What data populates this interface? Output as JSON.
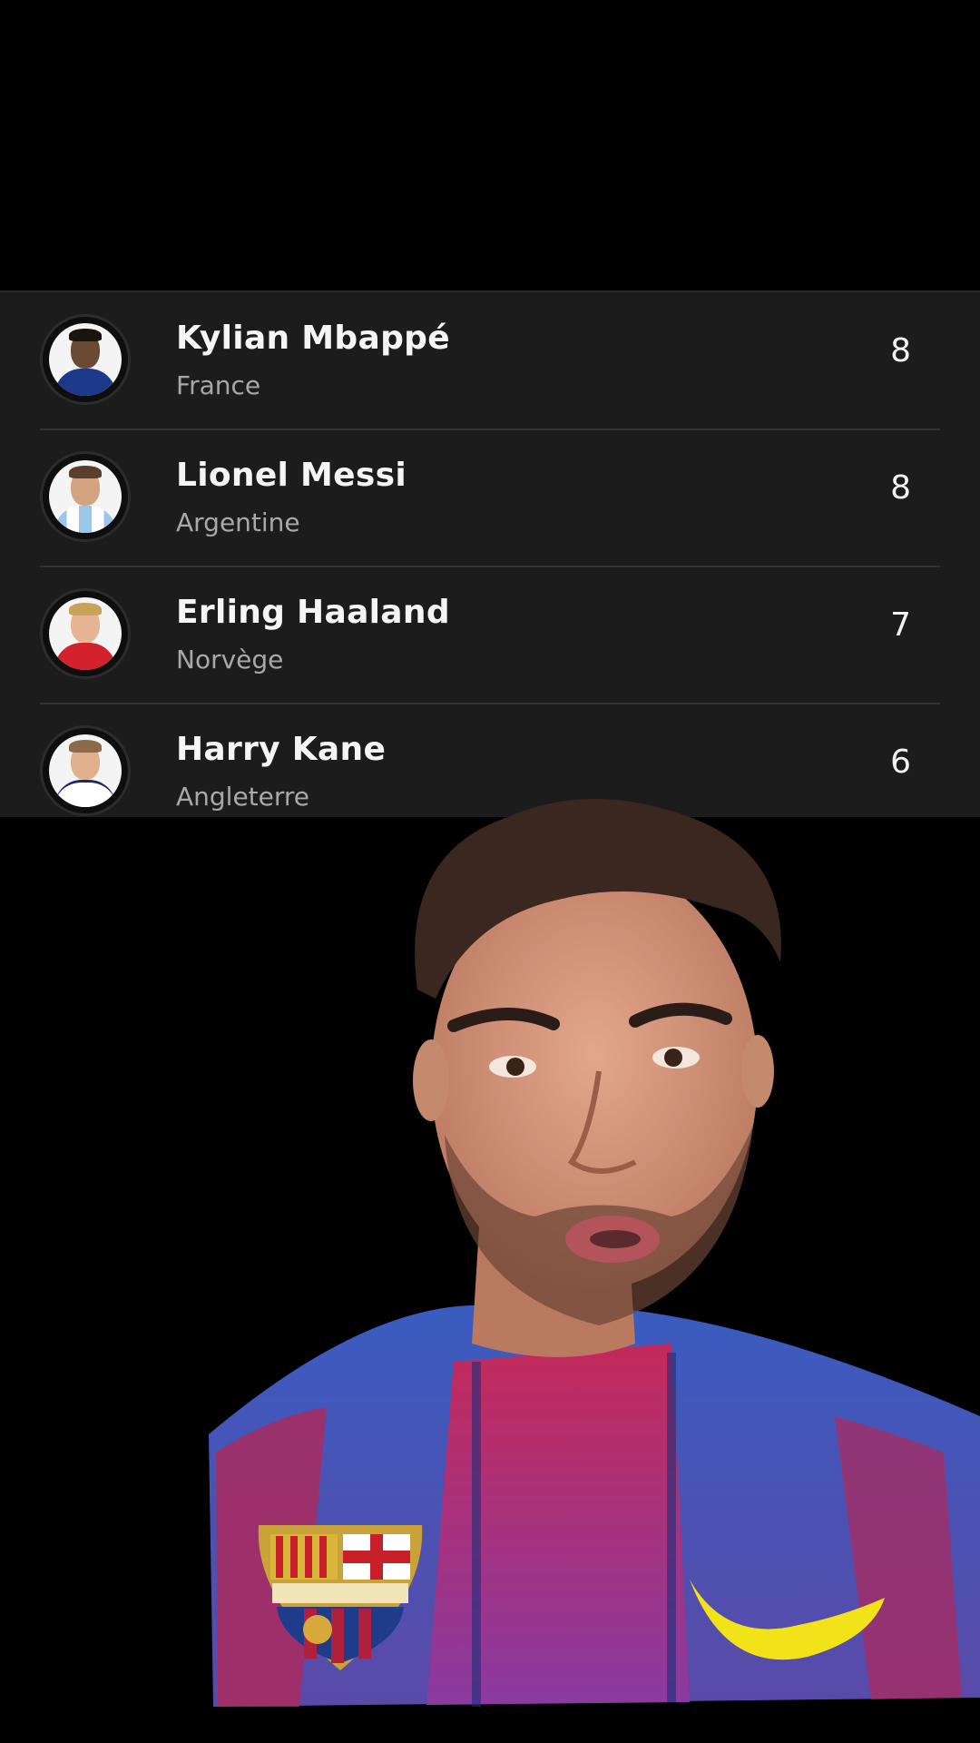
{
  "players": [
    {
      "name": "Kylian Mbappé",
      "country": "France",
      "value": "8"
    },
    {
      "name": "Lionel Messi",
      "country": "Argentine",
      "value": "8"
    },
    {
      "name": "Erling Haaland",
      "country": "Norvège",
      "value": "7"
    },
    {
      "name": "Harry Kane",
      "country": "Angleterre",
      "value": "6"
    }
  ],
  "colors": {
    "background": "#000000",
    "panel": "#1c1c1d",
    "divider": "#333334",
    "name_text": "#f5f5f5",
    "country_text": "#a8a8a8",
    "barca_blue": "#2e4fa8",
    "barca_red": "#b8285a",
    "nike_swoosh": "#f2e318"
  },
  "icons": [
    "player-avatar-mbappe",
    "player-avatar-messi",
    "player-avatar-haaland",
    "player-avatar-kane",
    "fc-barcelona-crest-icon",
    "nike-swoosh-icon"
  ]
}
